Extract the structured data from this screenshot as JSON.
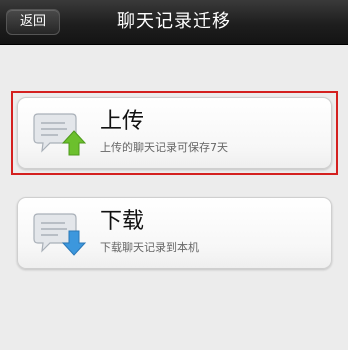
{
  "header": {
    "back_label": "返回",
    "title": "聊天记录迁移"
  },
  "options": [
    {
      "title": "上传",
      "description": "上传的聊天记录可保存7天",
      "icon": "chat-upload-icon",
      "arrow_color": "#6cc02d"
    },
    {
      "title": "下载",
      "description": "下载聊天记录到本机",
      "icon": "chat-download-icon",
      "arrow_color": "#3c97dd"
    }
  ],
  "colors": {
    "highlight_border": "#d4201f",
    "header_bg": "#1e1e1e"
  }
}
